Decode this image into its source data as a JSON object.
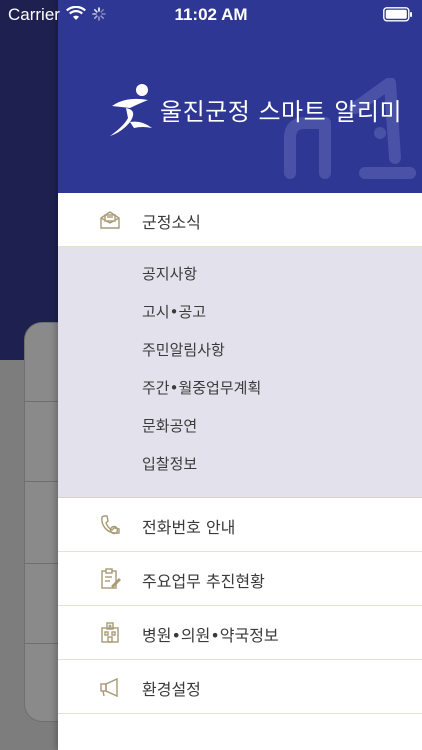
{
  "status_bar": {
    "carrier": "Carrier",
    "time": "11:02 AM"
  },
  "drawer": {
    "header": {
      "title": "울진군정 스마트 알리미",
      "background_color": "#2f3794"
    },
    "menu": {
      "section": {
        "label": "군정소식",
        "icon": "mail-open-icon",
        "subitems": [
          {
            "label": "공지사항"
          },
          {
            "label": "고시•공고"
          },
          {
            "label": "주민알림사항"
          },
          {
            "label": "주간•월중업무계획"
          },
          {
            "label": "문화공연"
          },
          {
            "label": "입찰정보"
          }
        ]
      },
      "items": [
        {
          "label": "전화번호 안내",
          "icon": "phone-icon"
        },
        {
          "label": "주요업무 추진현황",
          "icon": "clipboard-icon"
        },
        {
          "label": "병원•의원•약국정보",
          "icon": "hospital-icon"
        },
        {
          "label": "환경설정",
          "icon": "megaphone-icon"
        }
      ]
    }
  }
}
